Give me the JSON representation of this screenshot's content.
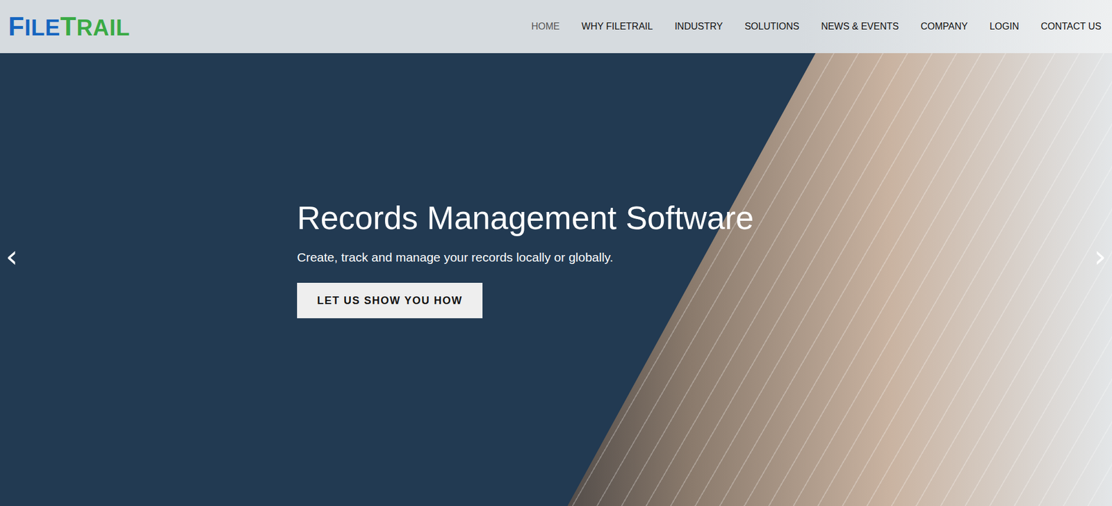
{
  "logo": {
    "first": "File",
    "second": "Trail"
  },
  "nav": [
    {
      "label": "HOME",
      "selected": true
    },
    {
      "label": "WHY FILETRAIL",
      "selected": false
    },
    {
      "label": "INDUSTRY",
      "selected": false
    },
    {
      "label": "SOLUTIONS",
      "selected": false
    },
    {
      "label": "NEWS & EVENTS",
      "selected": false
    },
    {
      "label": "COMPANY",
      "selected": false
    },
    {
      "label": "LOGIN",
      "selected": false
    },
    {
      "label": "CONTACT US",
      "selected": false
    }
  ],
  "hero": {
    "title": "Records Management Software",
    "subtitle": "Create, track and manage your records locally or globally.",
    "button": "LET US SHOW YOU HOW"
  },
  "carousel": {
    "prev": "‹",
    "next": "›"
  }
}
